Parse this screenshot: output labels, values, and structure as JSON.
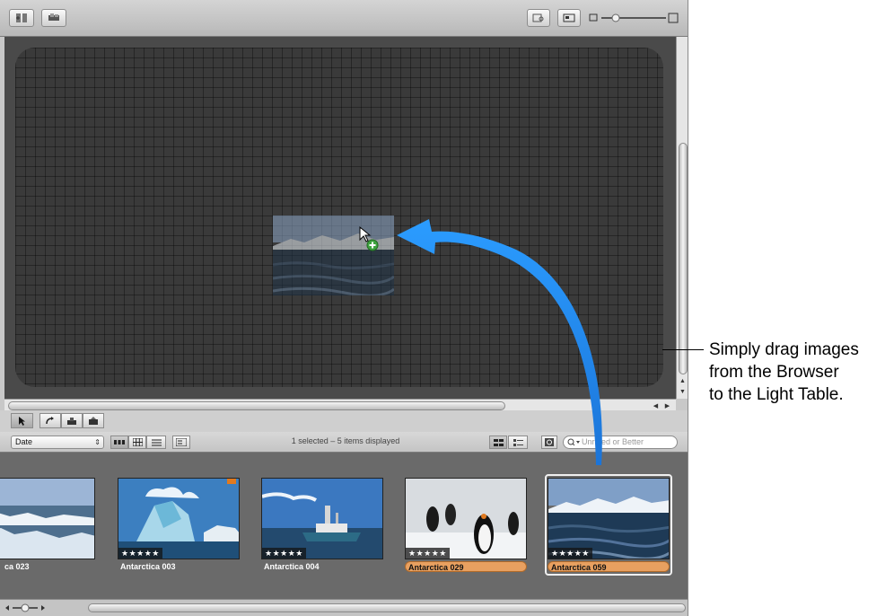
{
  "status": {
    "text": "1 selected – 5 items displayed"
  },
  "browser_toolbar": {
    "sort_value": "Date",
    "search_placeholder": "Unrated or Better"
  },
  "thumbnails": [
    {
      "caption": "ca 023",
      "stars": "★",
      "selected": false
    },
    {
      "caption": "Antarctica 003",
      "stars": "★★★★★",
      "selected": false
    },
    {
      "caption": "Antarctica 004",
      "stars": "★★★★★",
      "selected": false
    },
    {
      "caption": "Antarctica 029",
      "stars": "★★★★★",
      "selected": false
    },
    {
      "caption": "Antarctica 059",
      "stars": "★★★★★",
      "selected": true
    }
  ],
  "callout": {
    "text": "Simply drag images\nfrom the Browser\nto the Light Table."
  },
  "colors": {
    "arrow": "#1a8cff",
    "selection_label": "#e8a060",
    "light_table": "#3a3a3a"
  }
}
